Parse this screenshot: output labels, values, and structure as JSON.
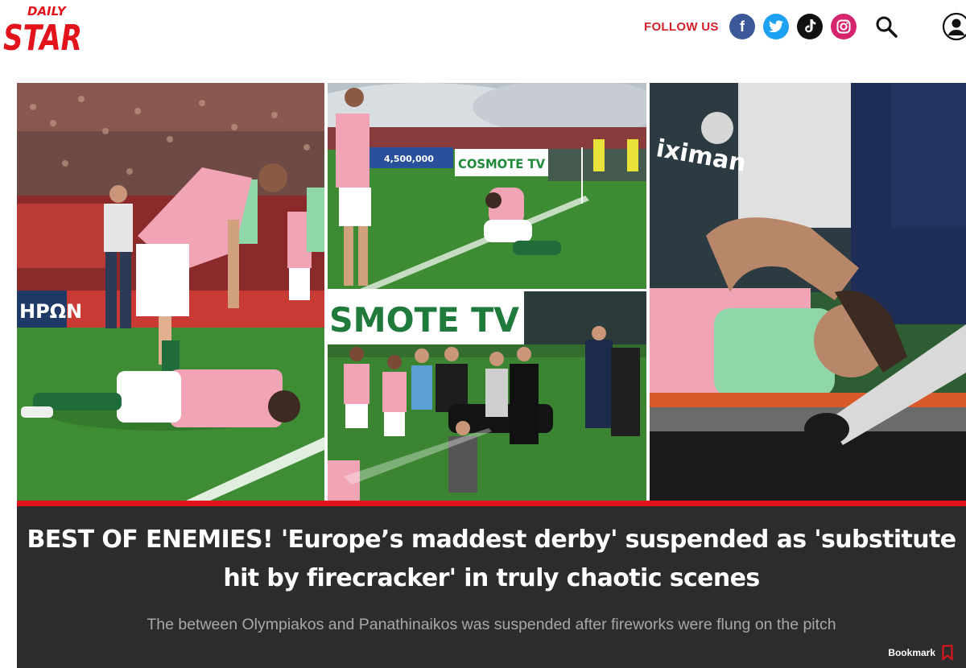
{
  "brand": {
    "logo_top": "DAILY",
    "logo_main": "STAR",
    "color": "#e3131b"
  },
  "header": {
    "follow_label": "FOLLOW US",
    "social": [
      {
        "name": "facebook-icon",
        "glyph": "f",
        "color": "#3b5998"
      },
      {
        "name": "twitter-icon",
        "glyph": "",
        "color": "#1da1f2"
      },
      {
        "name": "tiktok-icon",
        "glyph": "",
        "color": "#111111"
      },
      {
        "name": "instagram-icon",
        "glyph": "",
        "color": "#d6246e"
      }
    ],
    "search_icon": "search-icon",
    "account_icon": "account-icon"
  },
  "hero": {
    "panel_2_banner": "COSMOTE TV",
    "panel_2_board": "4,500,000",
    "panel_3_banner": "SMOTE TV",
    "panel_1_board": "ΗΡΩΝ",
    "panel_4_shirt": "iximan"
  },
  "article": {
    "headline": "BEST OF ENEMIES! 'Europe’s maddest derby' suspended as 'substitute hit by firecracker' in truly chaotic scenes",
    "standfirst": "The between Olympiakos and Panathinaikos was suspended after fireworks were flung on the pitch",
    "bookmark_label": "Bookmark",
    "accent": "#e3131b"
  }
}
